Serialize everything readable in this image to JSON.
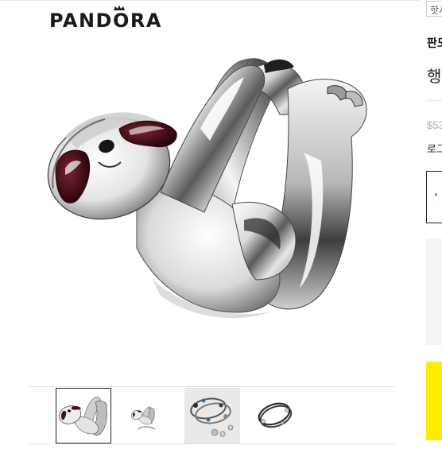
{
  "header": {
    "brand": "PANDORA"
  },
  "main_image": {
    "alt": "Silver sloth charm with enamel eye patches"
  },
  "thumbnails": [
    {
      "name": "sloth-charm",
      "selected": true
    },
    {
      "name": "sloth-charm-small",
      "selected": false
    },
    {
      "name": "bracelet-set",
      "selected": false
    },
    {
      "name": "cord-bracelet",
      "selected": false
    }
  ],
  "sidebar": {
    "language": "핫시",
    "brand_label": "판도",
    "product_title": "행",
    "price": "$53",
    "login_text": "로그"
  },
  "colors": {
    "brand_text": "#1a1a1a",
    "enamel": "#4a0f1a",
    "cta_yellow": "#ffed00",
    "silver_dark": "#2a2a2a",
    "silver_light": "#f2f2f2"
  }
}
